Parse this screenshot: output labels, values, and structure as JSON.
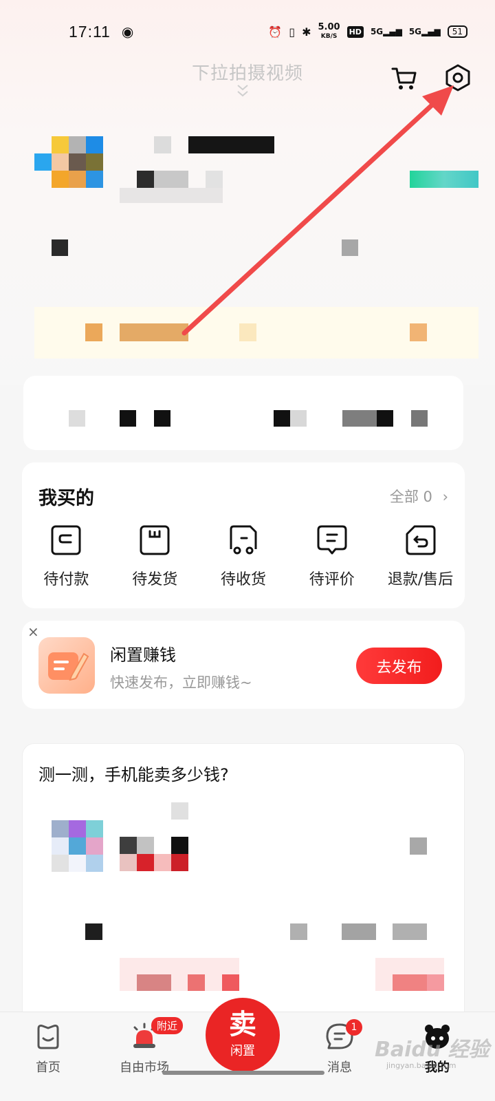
{
  "status_bar": {
    "time": "17:11",
    "weibo_icon": "weibo-icon",
    "net_speed_value": "5.00",
    "net_speed_unit": "KB/S",
    "hd_label": "HD",
    "signal_1": "5G",
    "signal_2": "5G",
    "battery": "51"
  },
  "header": {
    "pull_hint": "下拉拍摄视频",
    "cart_icon": "cart-icon",
    "settings_icon": "gear-icon"
  },
  "colors": {
    "accent_red": "#ea2525",
    "annotation_arrow": "#f04a4a"
  },
  "my_purchases": {
    "title": "我买的",
    "more_label": "全部 0",
    "items": [
      {
        "label": "待付款",
        "icon": "wallet-icon"
      },
      {
        "label": "待发货",
        "icon": "package-icon"
      },
      {
        "label": "待收货",
        "icon": "truck-icon"
      },
      {
        "label": "待评价",
        "icon": "comment-icon"
      },
      {
        "label": "退款/售后",
        "icon": "refund-icon"
      }
    ]
  },
  "promo": {
    "close": "×",
    "title": "闲置赚钱",
    "subtitle": "快速发布，立即赚钱~",
    "button": "去发布"
  },
  "phone_test": {
    "title": "测一测，手机能卖多少钱?"
  },
  "tabbar": {
    "tabs": [
      {
        "label": "首页",
        "icon": "home-icon"
      },
      {
        "label": "自由市场",
        "icon": "alarm-icon"
      },
      {
        "label": "消息",
        "icon": "message-icon"
      },
      {
        "label": "我的",
        "icon": "profile-icon"
      }
    ],
    "nearby_badge": "附近",
    "message_badge": "1",
    "sell_big": "卖",
    "sell_small": "闲置"
  },
  "watermark": {
    "main": "Baidu 经验",
    "sub": "jingyan.baidu.com"
  }
}
